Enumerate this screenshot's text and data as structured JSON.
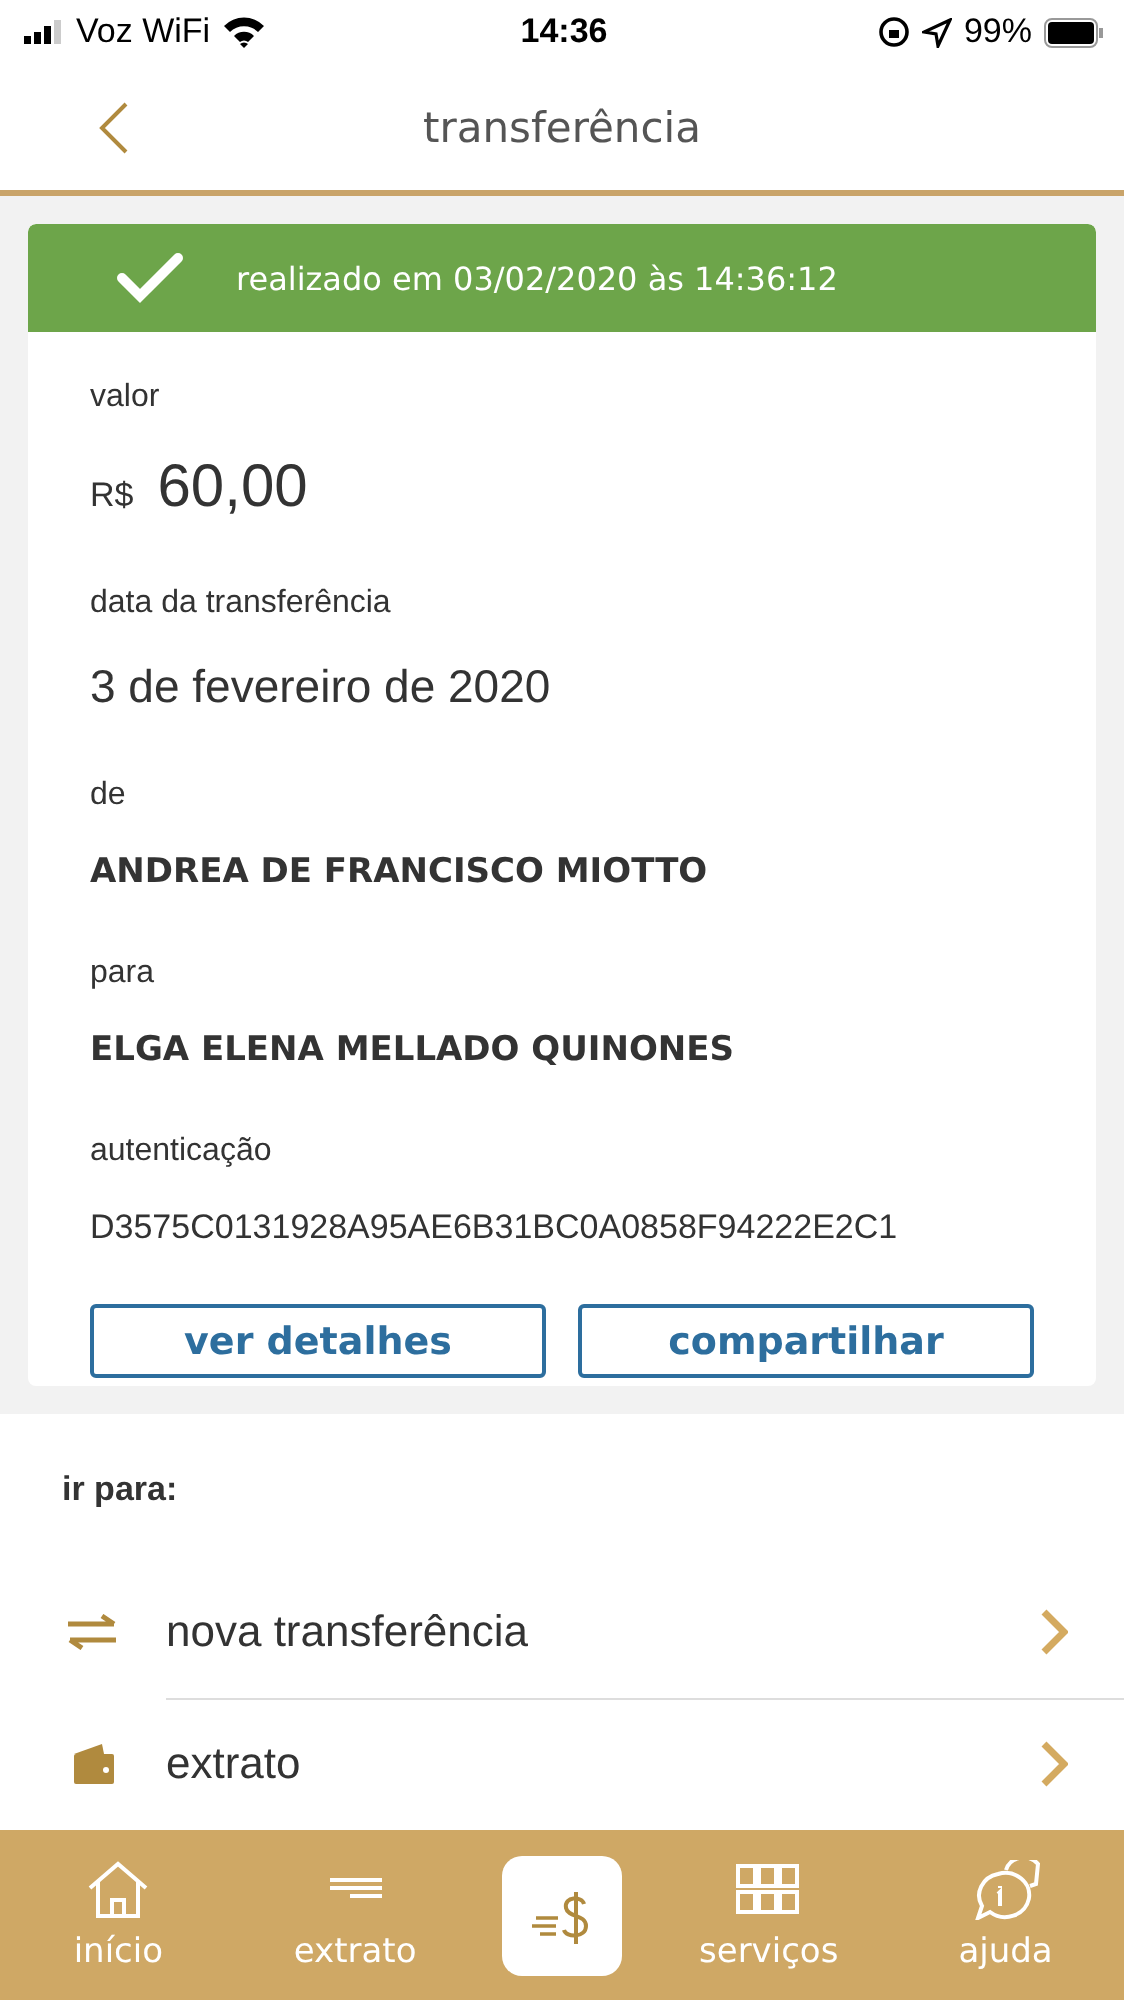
{
  "status_bar": {
    "carrier": "Voz WiFi",
    "time": "14:36",
    "battery": "99%"
  },
  "header": {
    "title": "transferência"
  },
  "receipt": {
    "banner": "realizado em 03/02/2020 às 14:36:12",
    "fields": [
      {
        "kind": "amount",
        "label": "valor",
        "currency": "R$",
        "value": "60,00"
      },
      {
        "kind": "text",
        "label": "data da transferência",
        "value": "3 de fevereiro de 2020"
      },
      {
        "kind": "name",
        "label": "de",
        "value": "ANDREA DE FRANCISCO MIOTTO"
      },
      {
        "kind": "name",
        "label": "para",
        "value": "ELGA ELENA MELLADO QUINONES"
      },
      {
        "kind": "text",
        "label": "autenticação",
        "value": "D3575C0131928A95AE6B31BC0A0858F94222E2C1"
      }
    ],
    "buttons": [
      "ver detalhes",
      "compartilhar"
    ]
  },
  "goto": {
    "title": "ir para:",
    "items": [
      {
        "kind": "transfer",
        "label": "nova transferência"
      },
      {
        "kind": "wallet",
        "label": "extrato"
      }
    ]
  },
  "tab_bar": {
    "items": [
      {
        "kind": "home",
        "label": "início"
      },
      {
        "kind": "lines",
        "label": "extrato"
      },
      {
        "kind": "center"
      },
      {
        "kind": "grid",
        "label": "serviços"
      },
      {
        "kind": "help",
        "label": "ajuda"
      }
    ]
  }
}
